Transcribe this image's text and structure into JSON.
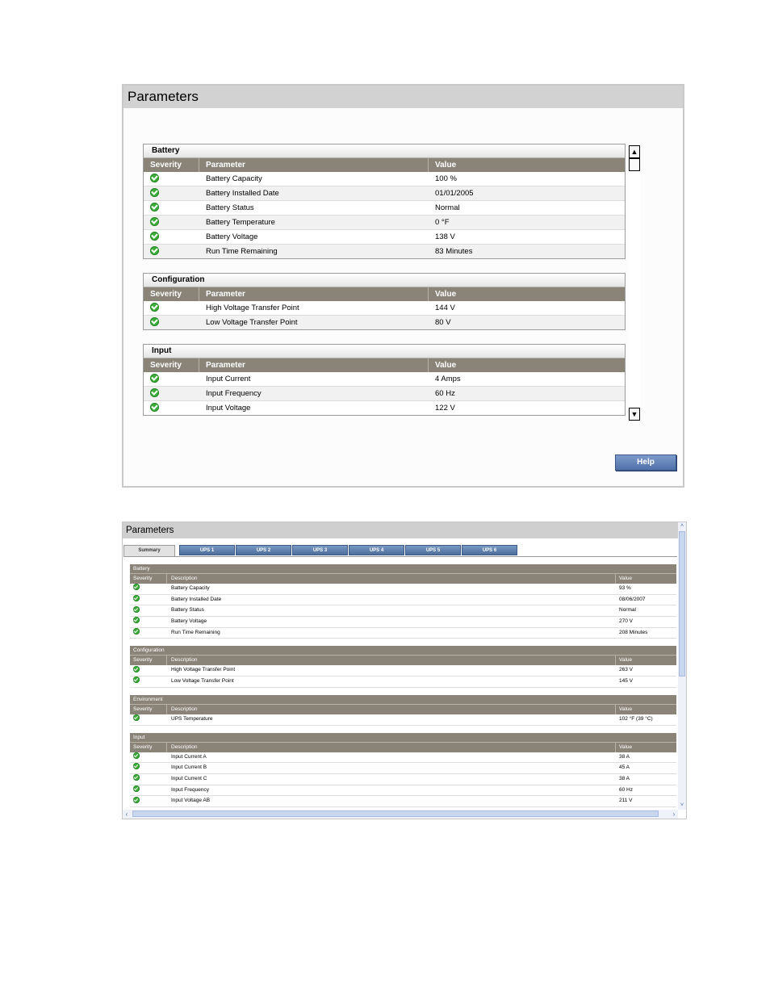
{
  "panel1": {
    "title": "Parameters",
    "help_label": "Help",
    "groups": [
      {
        "name": "Battery",
        "headers": [
          "Severity",
          "Parameter",
          "Value"
        ],
        "rows": [
          {
            "parameter": "Battery Capacity",
            "value": "100 %"
          },
          {
            "parameter": "Battery Installed Date",
            "value": "01/01/2005"
          },
          {
            "parameter": "Battery Status",
            "value": "Normal"
          },
          {
            "parameter": "Battery Temperature",
            "value": "0 °F"
          },
          {
            "parameter": "Battery Voltage",
            "value": "138 V"
          },
          {
            "parameter": "Run Time Remaining",
            "value": "83 Minutes"
          }
        ]
      },
      {
        "name": "Configuration",
        "headers": [
          "Severity",
          "Parameter",
          "Value"
        ],
        "rows": [
          {
            "parameter": "High Voltage Transfer Point",
            "value": "144 V"
          },
          {
            "parameter": "Low Voltage Transfer Point",
            "value": "80 V"
          }
        ]
      },
      {
        "name": "Input",
        "headers": [
          "Severity",
          "Parameter",
          "Value"
        ],
        "rows": [
          {
            "parameter": "Input Current",
            "value": "4 Amps"
          },
          {
            "parameter": "Input Frequency",
            "value": "60 Hz"
          },
          {
            "parameter": "Input Voltage",
            "value": "122 V"
          }
        ]
      }
    ]
  },
  "panel2": {
    "title": "Parameters",
    "tabs": [
      "Summary",
      "UPS 1",
      "UPS 2",
      "UPS 3",
      "UPS 4",
      "UPS 5",
      "UPS 6"
    ],
    "active_tab": "Summary",
    "groups": [
      {
        "name": "Battery",
        "headers": [
          "Severity",
          "Description",
          "Value"
        ],
        "rows": [
          {
            "parameter": "Battery Capacity",
            "value": "93 %"
          },
          {
            "parameter": "Battery Installed Date",
            "value": "08/06/2007"
          },
          {
            "parameter": "Battery Status",
            "value": "Normal"
          },
          {
            "parameter": "Battery Voltage",
            "value": "270 V"
          },
          {
            "parameter": "Run Time Remaining",
            "value": "208 Minutes"
          }
        ]
      },
      {
        "name": "Configuration",
        "headers": [
          "Severity",
          "Description",
          "Value"
        ],
        "rows": [
          {
            "parameter": "High Voltage Transfer Point",
            "value": "263 V"
          },
          {
            "parameter": "Low Voltage Transfer Point",
            "value": "145 V"
          }
        ]
      },
      {
        "name": "Environment",
        "headers": [
          "Severity",
          "Description",
          "Value"
        ],
        "rows": [
          {
            "parameter": "UPS Temperature",
            "value": "102 °F (39 °C)"
          }
        ]
      },
      {
        "name": "Input",
        "headers": [
          "Severity",
          "Description",
          "Value"
        ],
        "rows": [
          {
            "parameter": "Input Current A",
            "value": "38 A"
          },
          {
            "parameter": "Input Current B",
            "value": "45 A"
          },
          {
            "parameter": "Input Current C",
            "value": "38 A"
          },
          {
            "parameter": "Input Frequency",
            "value": "60 Hz"
          },
          {
            "parameter": "Input Voltage AB",
            "value": "211 V"
          }
        ]
      }
    ]
  },
  "status_icon": "ok-check-icon",
  "colors": {
    "header_bg": "#8a8478",
    "ok_green": "#3cae3a",
    "tab_blue": "#5a7aab",
    "help_blue": "#5f7fb6"
  }
}
